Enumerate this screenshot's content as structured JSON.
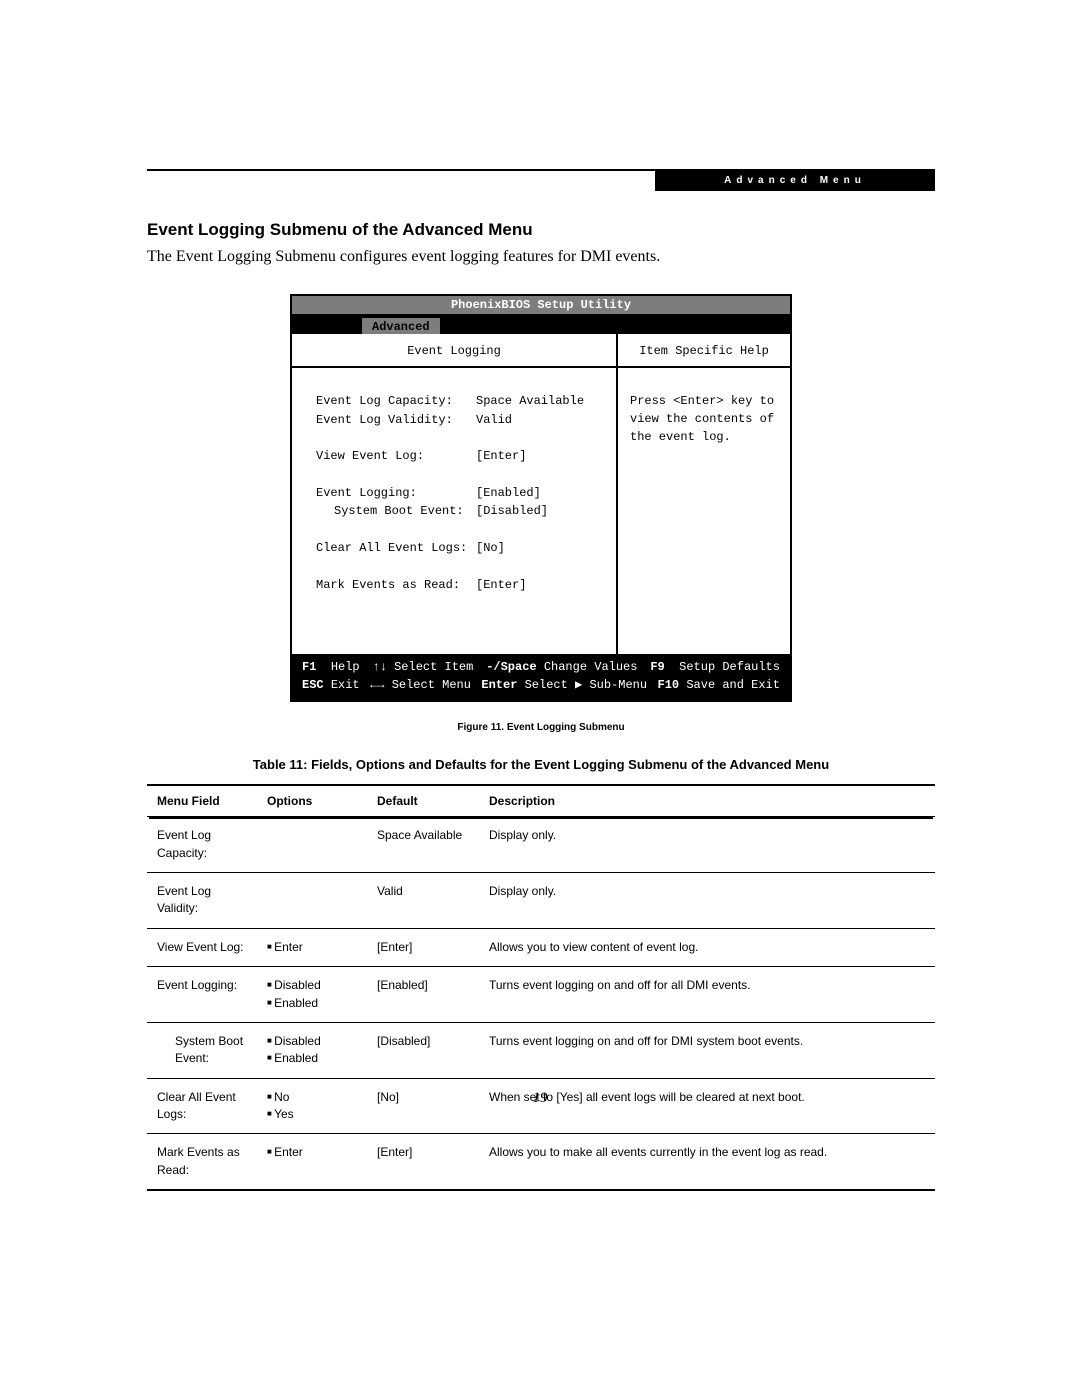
{
  "badge": "Advanced Menu",
  "section_title": "Event Logging Submenu of the Advanced Menu",
  "intro": "The Event Logging Submenu configures event logging features for DMI events.",
  "bios": {
    "title": "PhoenixBIOS Setup Utility",
    "active_tab": "Advanced",
    "left_header": "Event Logging",
    "right_header": "Item Specific Help",
    "help_text": "Press <Enter> key to view the contents of the event log.",
    "fields": [
      {
        "label": "Event Log Capacity:",
        "value": "Space Available",
        "indent": false,
        "gap_after": false
      },
      {
        "label": "Event Log Validity:",
        "value": "Valid",
        "indent": false,
        "gap_after": true
      },
      {
        "label": "View Event Log:",
        "value": "[Enter]",
        "indent": false,
        "gap_after": true
      },
      {
        "label": "Event Logging:",
        "value": "[Enabled]",
        "indent": false,
        "gap_after": false
      },
      {
        "label": "System Boot Event:",
        "value": "[Disabled]",
        "indent": true,
        "gap_after": true
      },
      {
        "label": "Clear All Event Logs:",
        "value": "[No]",
        "indent": false,
        "gap_after": true
      },
      {
        "label": "Mark Events as Read:",
        "value": "[Enter]",
        "indent": false,
        "gap_after": false
      }
    ],
    "footer": {
      "r1c1_key": "F1",
      "r1c1_txt": "Help",
      "r1c2_key": "↑↓",
      "r1c2_txt": "Select Item",
      "r1c3_key": "-/Space",
      "r1c3_txt": "Change Values",
      "r1c4_key": "F9",
      "r1c4_txt": "Setup Defaults",
      "r2c1_key": "ESC",
      "r2c1_txt": "Exit",
      "r2c2_key": "←→",
      "r2c2_txt": "Select Menu",
      "r2c3_key": "Enter",
      "r2c3_txt": "Select ▶ Sub-Menu",
      "r2c4_key": "F10",
      "r2c4_txt": "Save and Exit"
    }
  },
  "figure_caption": "Figure 11.   Event Logging Submenu",
  "table_caption": "Table 11: Fields, Options and Defaults for the Event Logging Submenu of the Advanced Menu",
  "table": {
    "headers": [
      "Menu Field",
      "Options",
      "Default",
      "Description"
    ],
    "rows": [
      {
        "field": "Event Log Capacity:",
        "indent": false,
        "options": [],
        "default": "Space Available",
        "desc": "Display only."
      },
      {
        "field": "Event Log Validity:",
        "indent": false,
        "options": [],
        "default": "Valid",
        "desc": "Display only."
      },
      {
        "field": "View Event Log:",
        "indent": false,
        "options": [
          "Enter"
        ],
        "default": "[Enter]",
        "desc": "Allows you to view content of event log."
      },
      {
        "field": "Event Logging:",
        "indent": false,
        "options": [
          "Disabled",
          "Enabled"
        ],
        "default": "[Enabled]",
        "desc": "Turns event logging on and off for all DMI events."
      },
      {
        "field": "System Boot Event:",
        "indent": true,
        "options": [
          "Disabled",
          "Enabled"
        ],
        "default": "[Disabled]",
        "desc": "Turns event logging on and off for DMI system boot events."
      },
      {
        "field": "Clear All Event Logs:",
        "indent": false,
        "options": [
          "No",
          "Yes"
        ],
        "default": "[No]",
        "desc": "When set to [Yes] all event logs will be cleared at next boot."
      },
      {
        "field": "Mark Events as Read:",
        "indent": false,
        "options": [
          "Enter"
        ],
        "default": "[Enter]",
        "desc": "Allows you to make all events currently in the event log as read."
      }
    ]
  },
  "page_number": "19"
}
